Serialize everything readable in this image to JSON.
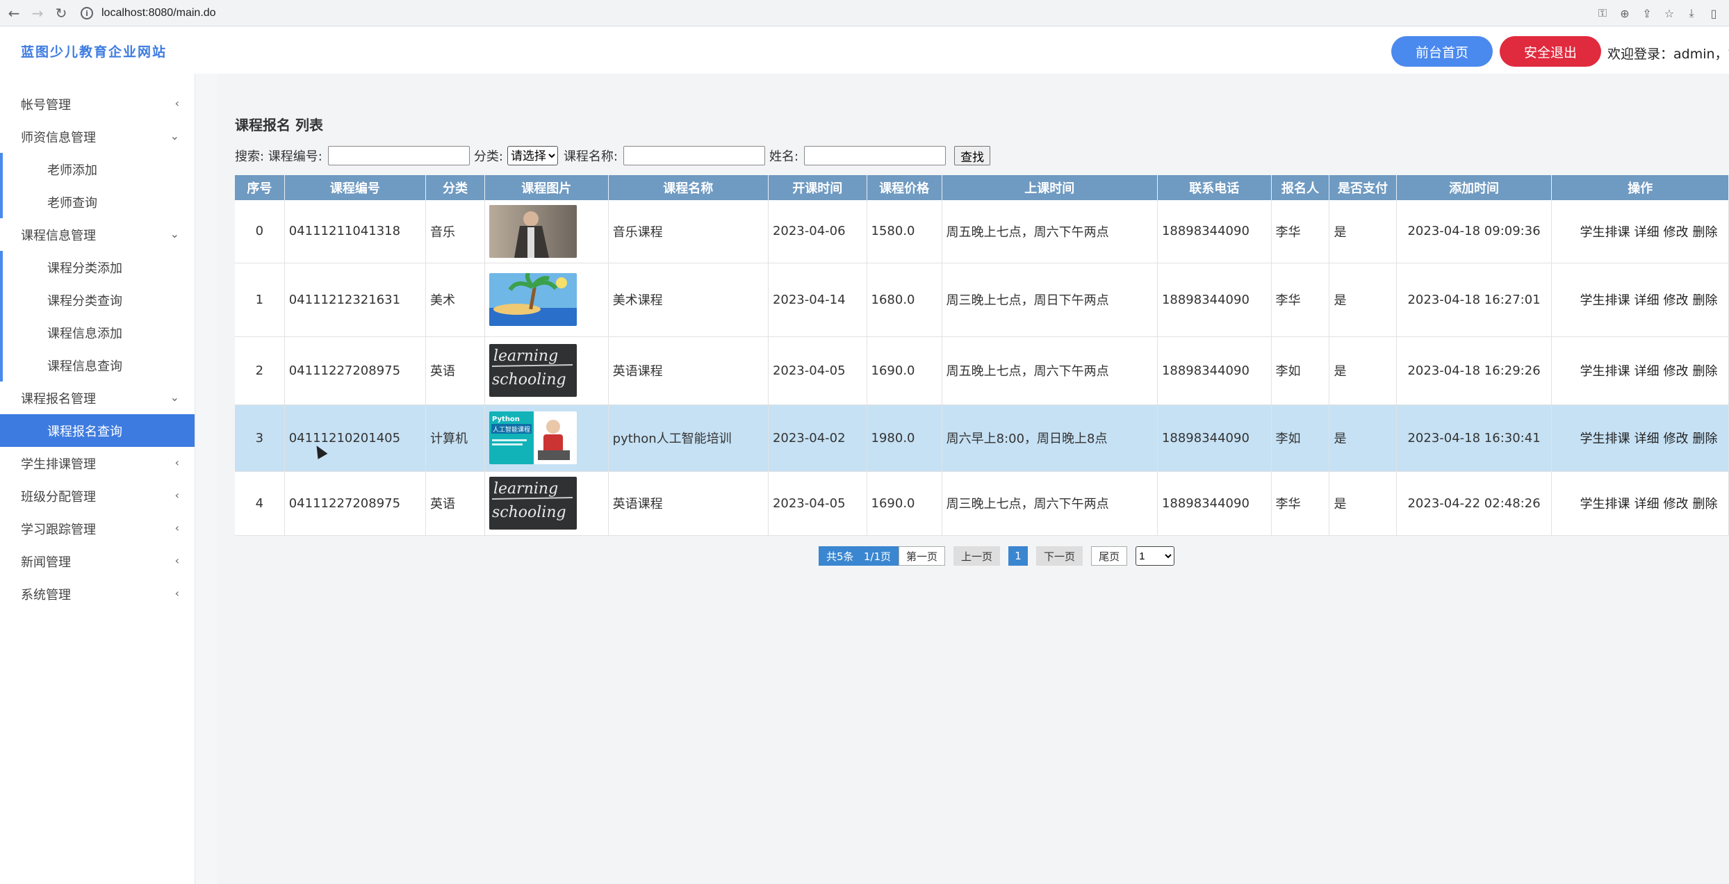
{
  "browser": {
    "url": "localhost:8080/main.do",
    "icons": [
      "back-icon",
      "forward-icon",
      "reload-icon",
      "info-icon",
      "key-icon",
      "zoom-icon",
      "share-icon",
      "star-icon",
      "download-icon",
      "sidebar-icon"
    ]
  },
  "header": {
    "brand": "蓝图少儿教育企业网站",
    "home_button": "前台首页",
    "logout_button": "安全退出",
    "welcome": "欢迎登录：admin，管"
  },
  "sidebar": {
    "items": [
      {
        "label": "帐号管理",
        "arrow": "‹"
      },
      {
        "label": "师资信息管理",
        "arrow": "⌄"
      },
      {
        "label": "老师添加"
      },
      {
        "label": "老师查询"
      },
      {
        "label": "课程信息管理",
        "arrow": "⌄"
      },
      {
        "label": "课程分类添加"
      },
      {
        "label": "课程分类查询"
      },
      {
        "label": "课程信息添加"
      },
      {
        "label": "课程信息查询"
      },
      {
        "label": "课程报名管理",
        "arrow": "⌄"
      },
      {
        "label": "课程报名查询"
      },
      {
        "label": "学生排课管理",
        "arrow": "‹"
      },
      {
        "label": "班级分配管理",
        "arrow": "‹"
      },
      {
        "label": "学习跟踪管理",
        "arrow": "‹"
      },
      {
        "label": "新闻管理",
        "arrow": "‹"
      },
      {
        "label": "系统管理",
        "arrow": "‹"
      }
    ]
  },
  "main": {
    "title": "课程报名 列表",
    "search": {
      "label_prefix": "搜索: 课程编号:",
      "category_label": "分类:",
      "category_selected": "请选择",
      "course_name_label": "课程名称:",
      "name_label": "姓名:",
      "search_button": "查找"
    },
    "table": {
      "headers": [
        "序号",
        "课程编号",
        "分类",
        "课程图片",
        "课程名称",
        "开课时间",
        "课程价格",
        "上课时间",
        "联系电话",
        "报名人",
        "是否支付",
        "添加时间",
        "操作"
      ],
      "rows": [
        {
          "idx": "0",
          "code": "04111211041318",
          "cat": "音乐",
          "name": "音乐课程",
          "start": "2023-04-06",
          "price": "1580.0",
          "time": "周五晚上七点，周六下午两点",
          "phone": "18898344090",
          "person": "李华",
          "paid": "是",
          "added": "2023-04-18 09:09:36"
        },
        {
          "idx": "1",
          "code": "04111212321631",
          "cat": "美术",
          "name": "美术课程",
          "start": "2023-04-14",
          "price": "1680.0",
          "time": "周三晚上七点，周日下午两点",
          "phone": "18898344090",
          "person": "李华",
          "paid": "是",
          "added": "2023-04-18 16:27:01"
        },
        {
          "idx": "2",
          "code": "04111227208975",
          "cat": "英语",
          "name": "英语课程",
          "start": "2023-04-05",
          "price": "1690.0",
          "time": "周五晚上七点，周六下午两点",
          "phone": "18898344090",
          "person": "李如",
          "paid": "是",
          "added": "2023-04-18 16:29:26"
        },
        {
          "idx": "3",
          "code": "0411121020140​5",
          "cat": "计算机",
          "name": "python人工智能培训",
          "start": "2023-04-02",
          "price": "1980.0",
          "time": "周六早上8:00，周日晚上8点",
          "phone": "18898344090",
          "person": "李如",
          "paid": "是",
          "added": "2023-04-18 16:30:41"
        },
        {
          "idx": "4",
          "code": "04111227208975",
          "cat": "英语",
          "name": "英语课程",
          "start": "2023-04-05",
          "price": "1690.0",
          "time": "周三晚上七点，周六下午两点",
          "phone": "18898344090",
          "person": "李华",
          "paid": "是",
          "added": "2023-04-22 02:48:26"
        }
      ],
      "ops": [
        "学生排课",
        "详细",
        "修改",
        "删除"
      ]
    },
    "pager": {
      "total": "共5条",
      "pages": "1/1页",
      "first": "第一页",
      "prev": "上一页",
      "current": "1",
      "next": "下一页",
      "last": "尾页",
      "select": "1"
    },
    "thumb_text": {
      "learning": "learning",
      "schooling": "schooling",
      "python_title": "Python",
      "python_sub": "人工智能课程"
    }
  }
}
